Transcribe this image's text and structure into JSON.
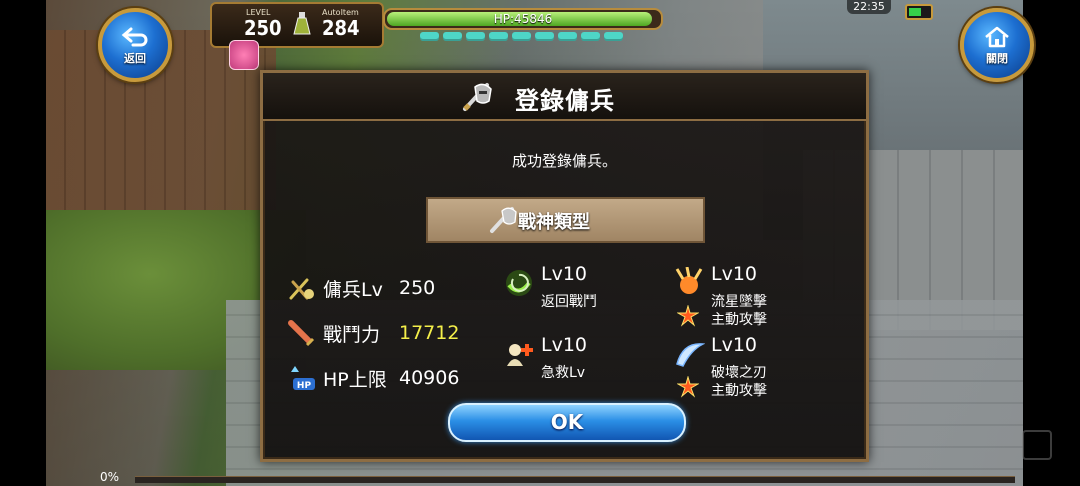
{
  "hud": {
    "back_label": "返回",
    "close_label": "關閉",
    "level_label": "LEVEL",
    "level_value": "250",
    "autoitem_label": "AutoItem",
    "autoitem_value": "284",
    "hp_text": "HP:45846",
    "hp_fill_fraction": 0.99,
    "clock": "22:35",
    "progress_percent": "0%"
  },
  "dialog": {
    "title": "登錄傭兵",
    "message": "成功登錄傭兵。",
    "type_label": "戰神類型",
    "stats": [
      {
        "label": "傭兵Lv",
        "value": "250",
        "icon": "mercenary-icon"
      },
      {
        "label": "戰鬥力",
        "value": "17712",
        "icon": "sword-icon"
      },
      {
        "label": "HP上限",
        "value": "40906",
        "icon": "hp-up-icon"
      }
    ],
    "skills": [
      {
        "level": "Lv10",
        "name": "返回戰鬥",
        "sub": "",
        "icon": "return-battle-icon"
      },
      {
        "level": "Lv10",
        "name": "流星墜擊",
        "sub": "主動攻擊",
        "icon": "meteor-icon"
      },
      {
        "level": "Lv10",
        "name": "急救Lv",
        "sub": "",
        "icon": "first-aid-icon"
      },
      {
        "level": "Lv10",
        "name": "破壞之刃",
        "sub": "主動攻擊",
        "icon": "blade-icon"
      }
    ],
    "ok_label": "OK"
  },
  "colors": {
    "highlight_value": "#f4ef4a",
    "button_blue": "#2b8fe6",
    "frame_gold": "#b78c3d",
    "hp_green": "#4ea722"
  }
}
